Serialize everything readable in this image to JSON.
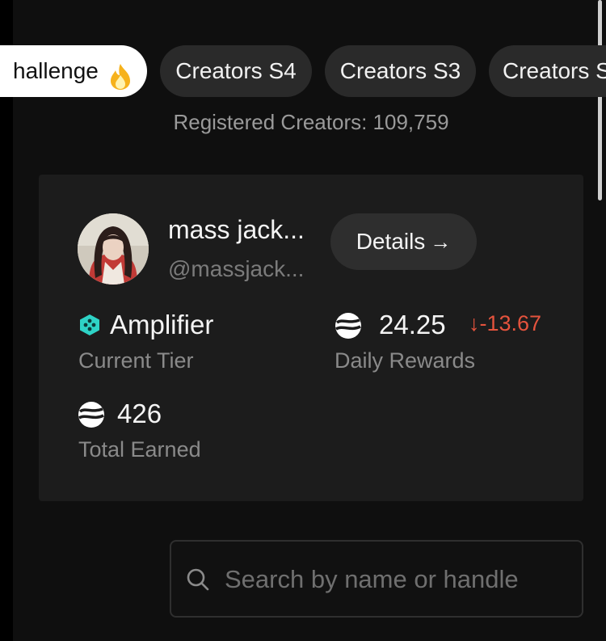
{
  "tabs": [
    {
      "label": "hallenge",
      "icon": "fire-icon",
      "active": true
    },
    {
      "label": "Creators S4",
      "active": false
    },
    {
      "label": "Creators S3",
      "active": false
    },
    {
      "label": "Creators S",
      "active": false
    }
  ],
  "registered": "Registered Creators: 109,759",
  "profile": {
    "name": "mass jack...",
    "handle": "@massjack...",
    "details_label": "Details",
    "tier": {
      "value": "Amplifier",
      "label": "Current Tier",
      "icon": "tier-hexagon-icon",
      "color": "#2ed3c6"
    },
    "daily": {
      "value": "24.25",
      "change": "-13.67",
      "label": "Daily Rewards",
      "icon": "reward-token-icon",
      "change_color": "#e5533d"
    },
    "total": {
      "value": "426",
      "label": "Total Earned",
      "icon": "reward-token-icon"
    }
  },
  "search": {
    "placeholder": "Search by name or handle",
    "value": ""
  }
}
